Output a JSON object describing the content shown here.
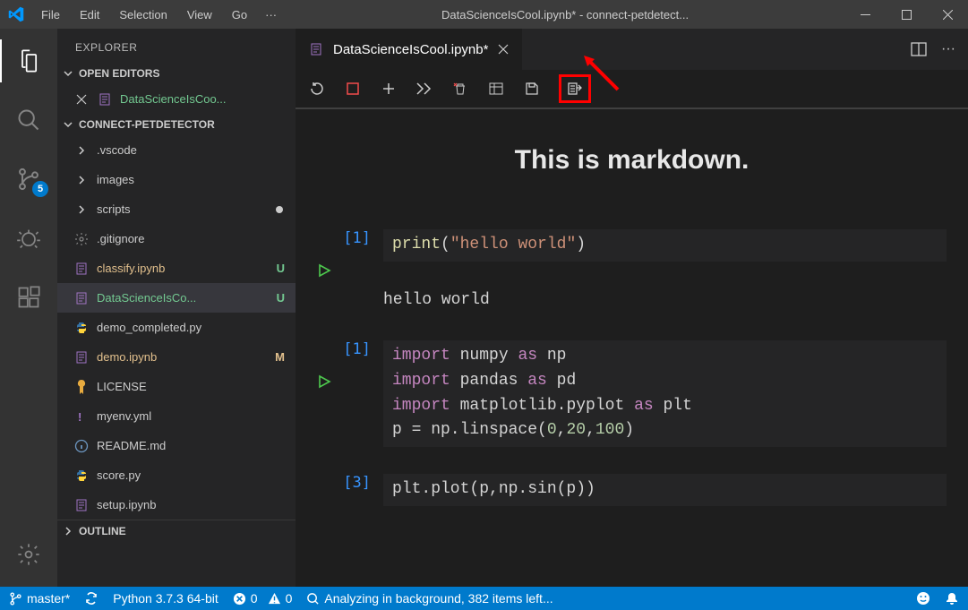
{
  "titlebar": {
    "menus": [
      "File",
      "Edit",
      "Selection",
      "View",
      "Go"
    ],
    "title": "DataScienceIsCool.ipynb* - connect-petdetect..."
  },
  "activitybar": {
    "scm_badge": "5"
  },
  "sidebar": {
    "title": "EXPLORER",
    "open_editors_label": "OPEN EDITORS",
    "open_editors": [
      {
        "name": "DataScienceIsCoo..."
      }
    ],
    "project_label": "CONNECT-PETDETECTOR",
    "outline_label": "OUTLINE",
    "tree": [
      {
        "kind": "folder",
        "name": ".vscode"
      },
      {
        "kind": "folder",
        "name": "images"
      },
      {
        "kind": "folder",
        "name": "scripts",
        "dirty": true
      },
      {
        "kind": "file",
        "icon": "gear",
        "name": ".gitignore"
      },
      {
        "kind": "file",
        "icon": "nb",
        "name": "classify.ipynb",
        "class": "name-yellow",
        "status": "U",
        "status_class": "status-u"
      },
      {
        "kind": "file",
        "icon": "nb",
        "name": "DataScienceIsCo...",
        "class": "name-green",
        "status": "U",
        "status_class": "status-u",
        "active": true
      },
      {
        "kind": "file",
        "icon": "py",
        "name": "demo_completed.py"
      },
      {
        "kind": "file",
        "icon": "nb",
        "name": "demo.ipynb",
        "class": "name-yellow",
        "status": "M",
        "status_class": "status-m"
      },
      {
        "kind": "file",
        "icon": "license",
        "name": "LICENSE"
      },
      {
        "kind": "file",
        "icon": "yml",
        "name": "myenv.yml"
      },
      {
        "kind": "file",
        "icon": "info",
        "name": "README.md"
      },
      {
        "kind": "file",
        "icon": "py",
        "name": "score.py"
      },
      {
        "kind": "file",
        "icon": "nb",
        "name": "setup.ipynb"
      }
    ]
  },
  "editor": {
    "tab_label": "DataScienceIsCool.ipynb*",
    "markdown": "This is markdown.",
    "cells": [
      {
        "exec": "[1]",
        "code_html": "<span class='fn'>print</span><span class='pl'>(</span><span class='str'>\"hello world\"</span><span class='pl'>)</span>",
        "output": "hello world",
        "play": true
      },
      {
        "exec": "[1]",
        "code_html": "<span class='kw'>import</span> <span class='pl'>numpy</span> <span class='kw'>as</span> <span class='pl'>np</span><br><span class='kw'>import</span> <span class='pl'>pandas</span> <span class='kw'>as</span> <span class='pl'>pd</span><br><span class='kw'>import</span> <span class='pl'>matplotlib.pyplot</span> <span class='kw'>as</span> <span class='pl'>plt</span><br><span class='pl'>p = np.linspace(</span><span class='num'>0</span><span class='pl'>,</span><span class='num'>20</span><span class='pl'>,</span><span class='num'>100</span><span class='pl'>)</span>",
        "play": true
      },
      {
        "exec": "[3]",
        "code_html": "<span class='pl'>plt.plot(p,np.sin(p))</span>"
      }
    ]
  },
  "statusbar": {
    "branch": "master*",
    "python": "Python 3.7.3 64-bit",
    "errors": "0",
    "warnings": "0",
    "analyzing": "Analyzing in background, 382 items left..."
  }
}
